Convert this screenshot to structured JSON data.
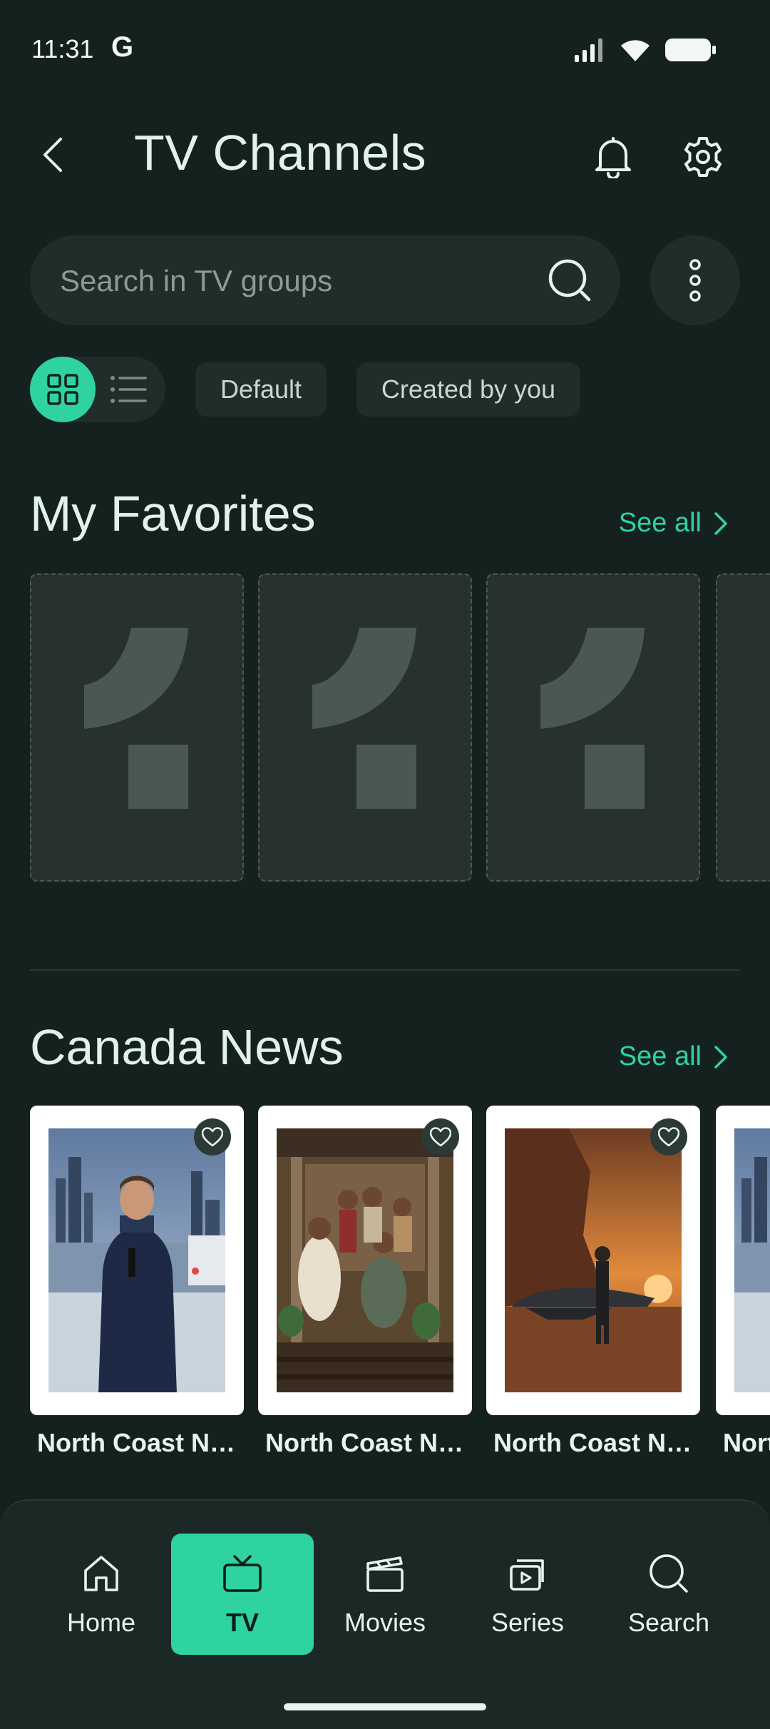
{
  "status_bar": {
    "time": "11:31",
    "g_logo": "G"
  },
  "header": {
    "title": "TV Channels"
  },
  "search": {
    "placeholder": "Search in TV groups"
  },
  "filters": {
    "view_mode": "grid",
    "chips": [
      "Default",
      "Created by you"
    ]
  },
  "favorites": {
    "title": "My Favorites",
    "see_all": "See all"
  },
  "canada_news": {
    "title": "Canada News",
    "see_all": "See all",
    "channels": [
      {
        "name": "North Coast News"
      },
      {
        "name": "North Coast News"
      },
      {
        "name": "North Coast News"
      },
      {
        "name": "North Coast News"
      }
    ]
  },
  "bottom_nav": {
    "items": [
      {
        "label": "Home",
        "icon": "home-icon"
      },
      {
        "label": "TV",
        "icon": "tv-icon",
        "active": true
      },
      {
        "label": "Movies",
        "icon": "clapperboard-icon"
      },
      {
        "label": "Series",
        "icon": "series-icon"
      },
      {
        "label": "Search",
        "icon": "search-icon"
      }
    ]
  },
  "colors": {
    "background": "#15211f",
    "surface": "#1f2e2b",
    "accent": "#2fd3a0",
    "text": "#e6f3ee"
  }
}
